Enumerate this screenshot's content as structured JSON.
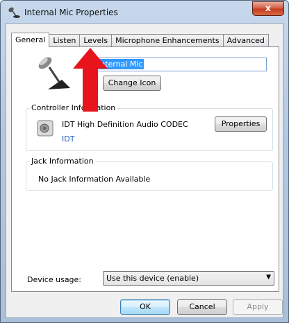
{
  "window": {
    "title": "Internal Mic Properties",
    "close_label": "x"
  },
  "tabs": [
    {
      "label": "General",
      "active": true
    },
    {
      "label": "Listen",
      "active": false
    },
    {
      "label": "Levels",
      "active": false
    },
    {
      "label": "Microphone Enhancements",
      "active": false
    },
    {
      "label": "Advanced",
      "active": false
    }
  ],
  "general": {
    "device_name": "Internal Mic",
    "change_icon_label": "Change Icon"
  },
  "controller": {
    "group_label": "Controller Information",
    "name": "IDT High Definition Audio CODEC",
    "vendor": "IDT",
    "properties_label": "Properties"
  },
  "jack": {
    "group_label": "Jack Information",
    "text": "No Jack Information Available"
  },
  "usage": {
    "label": "Device usage:",
    "selected": "Use this device (enable)"
  },
  "buttons": {
    "ok": "OK",
    "cancel": "Cancel",
    "apply": "Apply"
  },
  "icons": {
    "title": "microphone-icon",
    "device": "microphone-icon",
    "codec": "speaker-device-icon",
    "annotation": "red-arrow-icon"
  },
  "colors": {
    "annotation_arrow": "#e8141c",
    "selection": "#3399ff",
    "link_text": "#1f5fbf"
  }
}
